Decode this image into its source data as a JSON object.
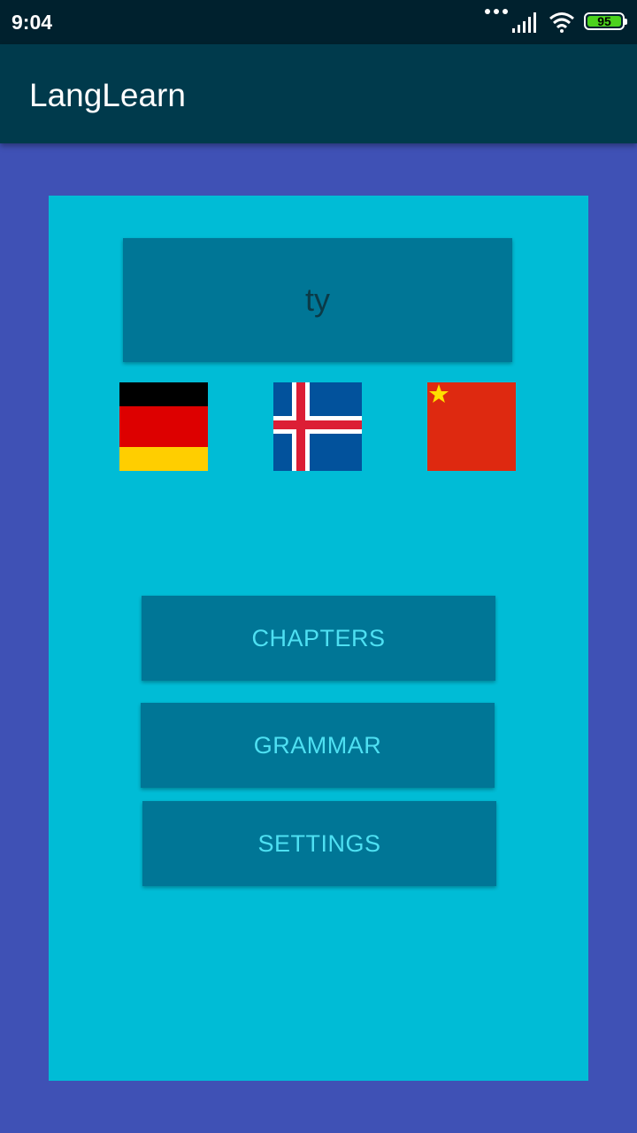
{
  "status_bar": {
    "time": "9:04",
    "battery_level": "95",
    "icons": [
      "more-dots-icon",
      "signal-icon",
      "wifi-icon",
      "battery-icon"
    ]
  },
  "app_bar": {
    "title": "LangLearn"
  },
  "main": {
    "word": "ty",
    "flags": [
      {
        "name": "germany-flag-icon"
      },
      {
        "name": "iceland-flag-icon"
      },
      {
        "name": "china-flag-icon"
      }
    ],
    "buttons": {
      "chapters": "CHAPTERS",
      "grammar": "GRAMMAR",
      "settings": "SETTINGS"
    }
  },
  "colors": {
    "background": "#3f51b5",
    "status_bar": "#00212e",
    "app_bar": "#003a4c",
    "card": "#00bcd6",
    "button": "#007696",
    "button_text": "#4ee0f2",
    "battery_fill": "#4cd21e"
  }
}
